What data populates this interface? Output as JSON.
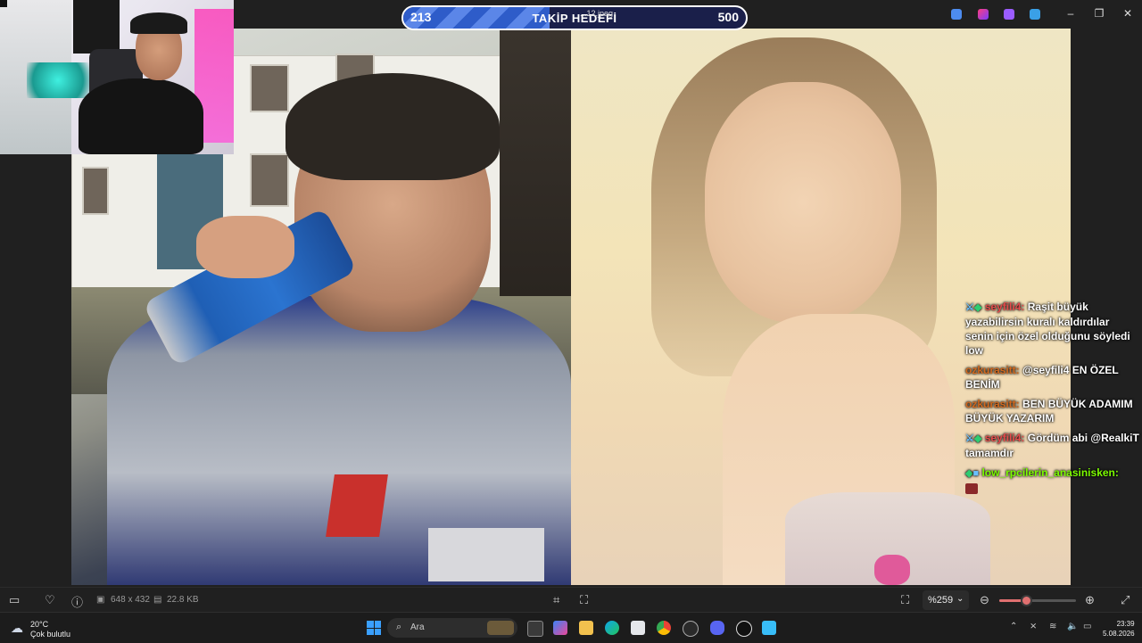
{
  "goal": {
    "current": "213",
    "title": "TAKİP HEDEFİ",
    "target": "500",
    "progress_fraction": 0.426
  },
  "file_name": "...12.jpeg",
  "chat": [
    {
      "user": "seyfili4:",
      "user_color": "#e54b4b",
      "badges": [
        "sword-icon",
        "gem-icon"
      ],
      "text": "Raşit büyük yazabilirsin kuralı kaldırdılar senin için özel olduğunu söyledi low"
    },
    {
      "user": "ozkurasitt:",
      "user_color": "#d2691e",
      "badges": [],
      "text": "@seyfili4 EN ÖZEL BENİM"
    },
    {
      "user": "ozkurasitt:",
      "user_color": "#d2691e",
      "badges": [],
      "text": "BEN BÜYÜK ADAMIM BÜYÜK YAZARIM"
    },
    {
      "user": "seyfili4:",
      "user_color": "#e54b4b",
      "badges": [
        "sword-icon",
        "gem-icon"
      ],
      "text": "Gördüm abi @RealkiT tamamdır"
    },
    {
      "user": "low_rpcilerin_anasinisken:",
      "user_color": "#7cfc00",
      "badges": [
        "gem-icon",
        "cube-icon"
      ],
      "text": ""
    }
  ],
  "viewer_bar": {
    "dimensions": "648 x 432",
    "file_size": "22.8 KB",
    "zoom": "%259",
    "zoom_fraction": 0.35
  },
  "taskbar": {
    "temperature": "20°C",
    "weather": "Çok bulutlu",
    "search_placeholder": "Ara",
    "time": "23:39",
    "date": "5.08.2026"
  },
  "colors": {
    "goal_fill": "#2e5cc9",
    "zoom_accent": "#e07070",
    "background": "#202020"
  }
}
